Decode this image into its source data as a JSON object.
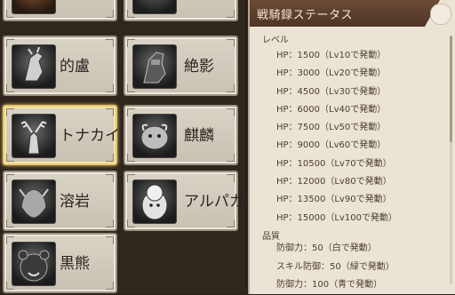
{
  "grid": {
    "cards": [
      {
        "name": "",
        "icon": "horse-icon"
      },
      {
        "name": "",
        "icon": "armored-horse-icon"
      },
      {
        "name": "的盧",
        "icon": "dragon-horse-icon"
      },
      {
        "name": "絶影",
        "icon": "armored-horse-icon"
      },
      {
        "name": "トナカイ",
        "icon": "reindeer-icon",
        "selected": true
      },
      {
        "name": "麒麟",
        "icon": "qilin-icon"
      },
      {
        "name": "溶岩",
        "icon": "lava-beast-icon"
      },
      {
        "name": "アルパカ",
        "icon": "alpaca-icon"
      },
      {
        "name": "黒熊",
        "icon": "black-bear-icon"
      }
    ]
  },
  "panel": {
    "title": "戦騎録ステータス",
    "level_label": "レベル",
    "hp_rows": [
      "HP：1500（Lv10で発動）",
      "HP：3000（Lv20で発動）",
      "HP：4500（Lv30で発動）",
      "HP：6000（Lv40で発動）",
      "HP：7500（Lv50で発動）",
      "HP：9000（Lv60で発動）",
      "HP：10500（Lv70で発動）",
      "HP：12000（Lv80で発動）",
      "HP：13500（Lv90で発動）",
      "HP：15000（Lv100で発動）"
    ],
    "quality_label": "品質",
    "defense_rows": [
      "防御力：50（白で発動）",
      "スキル防御：50（緑で発動）",
      "防御力：100（青で発動）"
    ]
  },
  "colors": {
    "panel_bg": "#ebe4d6",
    "header_bg": "#5a3f2c",
    "selected_border": "#e7c66f",
    "card_bg": "#d4cdbf"
  }
}
